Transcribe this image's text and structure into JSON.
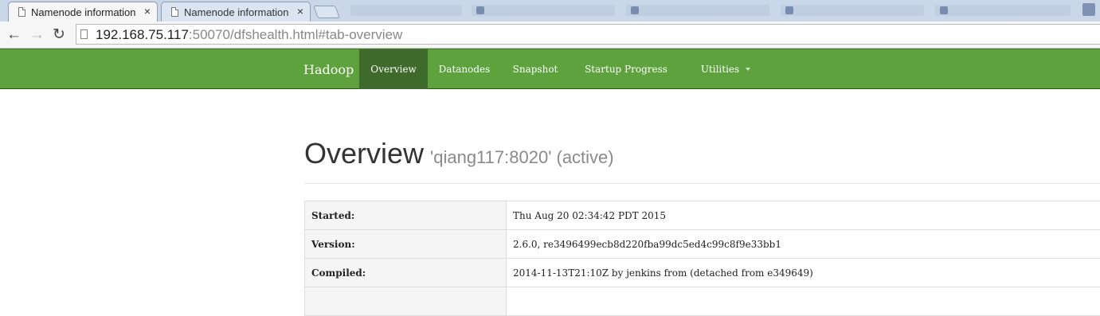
{
  "browser": {
    "tabs": [
      {
        "title": "Namenode information",
        "close": "×",
        "active": true
      },
      {
        "title": "Namenode information",
        "close": "×",
        "active": false
      }
    ],
    "url_host": "192.168.75.117",
    "url_rest": ":50070/dfshealth.html#tab-overview",
    "back_glyph": "←",
    "forward_glyph": "→",
    "reload_glyph": "↻"
  },
  "navbar": {
    "brand": "Hadoop",
    "items": [
      {
        "label": "Overview",
        "active": true
      },
      {
        "label": "Datanodes"
      },
      {
        "label": "Snapshot"
      },
      {
        "label": "Startup Progress"
      },
      {
        "label": "Utilities",
        "dropdown": true
      }
    ],
    "colors": {
      "bar": "#5ea23e",
      "active": "#3e6a2b"
    }
  },
  "overview": {
    "title": "Overview",
    "subtitle": "'qiang117:8020' (active)",
    "rows": [
      {
        "key": "Started:",
        "value": "Thu Aug 20 02:34:42 PDT 2015"
      },
      {
        "key": "Version:",
        "value": "2.6.0, re3496499ecb8d220fba99dc5ed4c99c8f9e33bb1"
      },
      {
        "key": "Compiled:",
        "value": "2014-11-13T21:10Z by jenkins from (detached from e349649)"
      },
      {
        "key": "",
        "value": ""
      }
    ]
  }
}
